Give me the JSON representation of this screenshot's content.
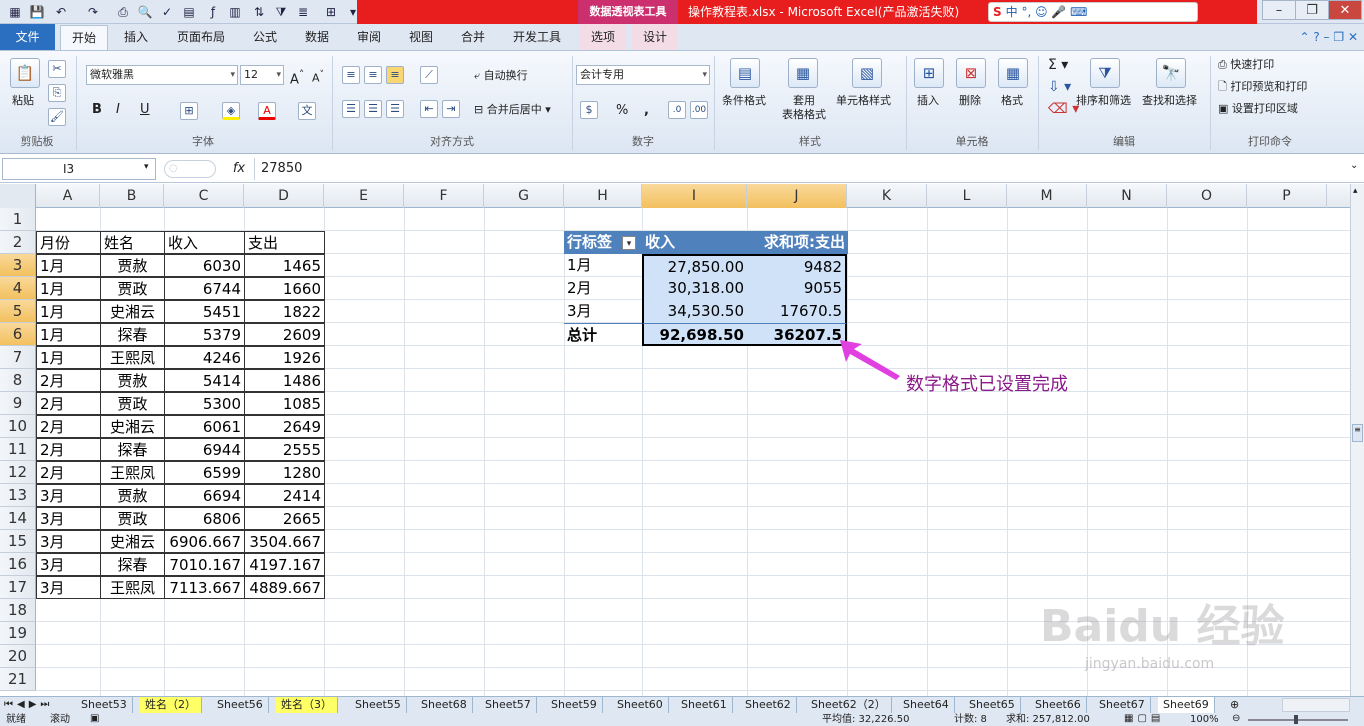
{
  "window": {
    "context_tool": "数据透视表工具",
    "title": "操作教程表.xlsx - Microsoft Excel(产品激活失败)",
    "ime": "中 °, ☺ 🎤 ⌨"
  },
  "tabs": [
    "文件",
    "开始",
    "插入",
    "页面布局",
    "公式",
    "数据",
    "审阅",
    "视图",
    "合并",
    "开发工具",
    "选项",
    "设计"
  ],
  "ribbon": {
    "clipboard": {
      "paste": "粘贴",
      "label": "剪贴板"
    },
    "font": {
      "name": "微软雅黑",
      "size": "12",
      "bold": "B",
      "italic": "I",
      "underline": "U",
      "label": "字体"
    },
    "alignment": {
      "wrap": "自动换行",
      "merge": "合并后居中",
      "label": "对齐方式"
    },
    "number": {
      "format": "会计专用",
      "label": "数字",
      "percent": "%",
      "comma": ","
    },
    "styles": {
      "conditional": "条件格式",
      "table_fmt": "套用\n表格格式",
      "cell_styles": "单元格样式",
      "label": "样式"
    },
    "cells": {
      "insert": "插入",
      "delete": "删除",
      "format": "格式",
      "label": "单元格"
    },
    "editing": {
      "sort": "排序和筛选",
      "find": "查找和选择",
      "label": "编辑"
    },
    "print": {
      "quick": "快速打印",
      "preview": "打印预览和打印",
      "area": "设置打印区域",
      "label": "打印命令"
    }
  },
  "formula_bar": {
    "name_box": "I3",
    "fx": "fx",
    "value": "27850"
  },
  "columns": [
    "A",
    "B",
    "C",
    "D",
    "E",
    "F",
    "G",
    "H",
    "I",
    "J",
    "K",
    "L",
    "M",
    "N",
    "O",
    "P"
  ],
  "rows": [
    "1",
    "2",
    "3",
    "4",
    "5",
    "6",
    "7",
    "8",
    "9",
    "10",
    "11",
    "12",
    "13",
    "14",
    "15",
    "16",
    "17",
    "18",
    "19",
    "20",
    "21"
  ],
  "table": {
    "headers": [
      "月份",
      "姓名",
      "收入",
      "支出"
    ],
    "rows": [
      [
        "1月",
        "贾赦",
        "6030",
        "1465"
      ],
      [
        "1月",
        "贾政",
        "6744",
        "1660"
      ],
      [
        "1月",
        "史湘云",
        "5451",
        "1822"
      ],
      [
        "1月",
        "探春",
        "5379",
        "2609"
      ],
      [
        "1月",
        "王熙凤",
        "4246",
        "1926"
      ],
      [
        "2月",
        "贾赦",
        "5414",
        "1486"
      ],
      [
        "2月",
        "贾政",
        "5300",
        "1085"
      ],
      [
        "2月",
        "史湘云",
        "6061",
        "2649"
      ],
      [
        "2月",
        "探春",
        "6944",
        "2555"
      ],
      [
        "2月",
        "王熙凤",
        "6599",
        "1280"
      ],
      [
        "3月",
        "贾赦",
        "6694",
        "2414"
      ],
      [
        "3月",
        "贾政",
        "6806",
        "2665"
      ],
      [
        "3月",
        "史湘云",
        "6906.667",
        "3504.667"
      ],
      [
        "3月",
        "探春",
        "7010.167",
        "4197.167"
      ],
      [
        "3月",
        "王熙凤",
        "7113.667",
        "4889.667"
      ]
    ]
  },
  "pivot": {
    "headers": [
      "行标签",
      "收入",
      "求和项:支出"
    ],
    "rows": [
      [
        "1月",
        "27,850.00",
        "9482"
      ],
      [
        "2月",
        "30,318.00",
        "9055"
      ],
      [
        "3月",
        "34,530.50",
        "17670.5"
      ]
    ],
    "total": [
      "总计",
      "92,698.50",
      "36207.5"
    ]
  },
  "annotation": "数字格式已设置完成",
  "sheets": [
    "Sheet53",
    "姓名（2）",
    "Sheet56",
    "姓名（3）",
    "Sheet55",
    "Sheet68",
    "Sheet57",
    "Sheet59",
    "Sheet60",
    "Sheet61",
    "Sheet62",
    "Sheet62（2）",
    "Sheet64",
    "Sheet65",
    "Sheet66",
    "Sheet67",
    "Sheet69"
  ],
  "status": {
    "ready": "就绪",
    "scroll": "滚动",
    "average": "平均值: 32,226.50",
    "count": "计数: 8",
    "sum": "求和: 257,812.00",
    "zoom": "100%"
  },
  "watermark": {
    "brand": "Baidu 经验",
    "url": "jingyan.baidu.com"
  },
  "colors": {
    "pivot_header": "#4f81bd",
    "selection": "#cfe2f8",
    "accent_arrow": "#e040e0",
    "annotation": "#8a1a8a"
  }
}
